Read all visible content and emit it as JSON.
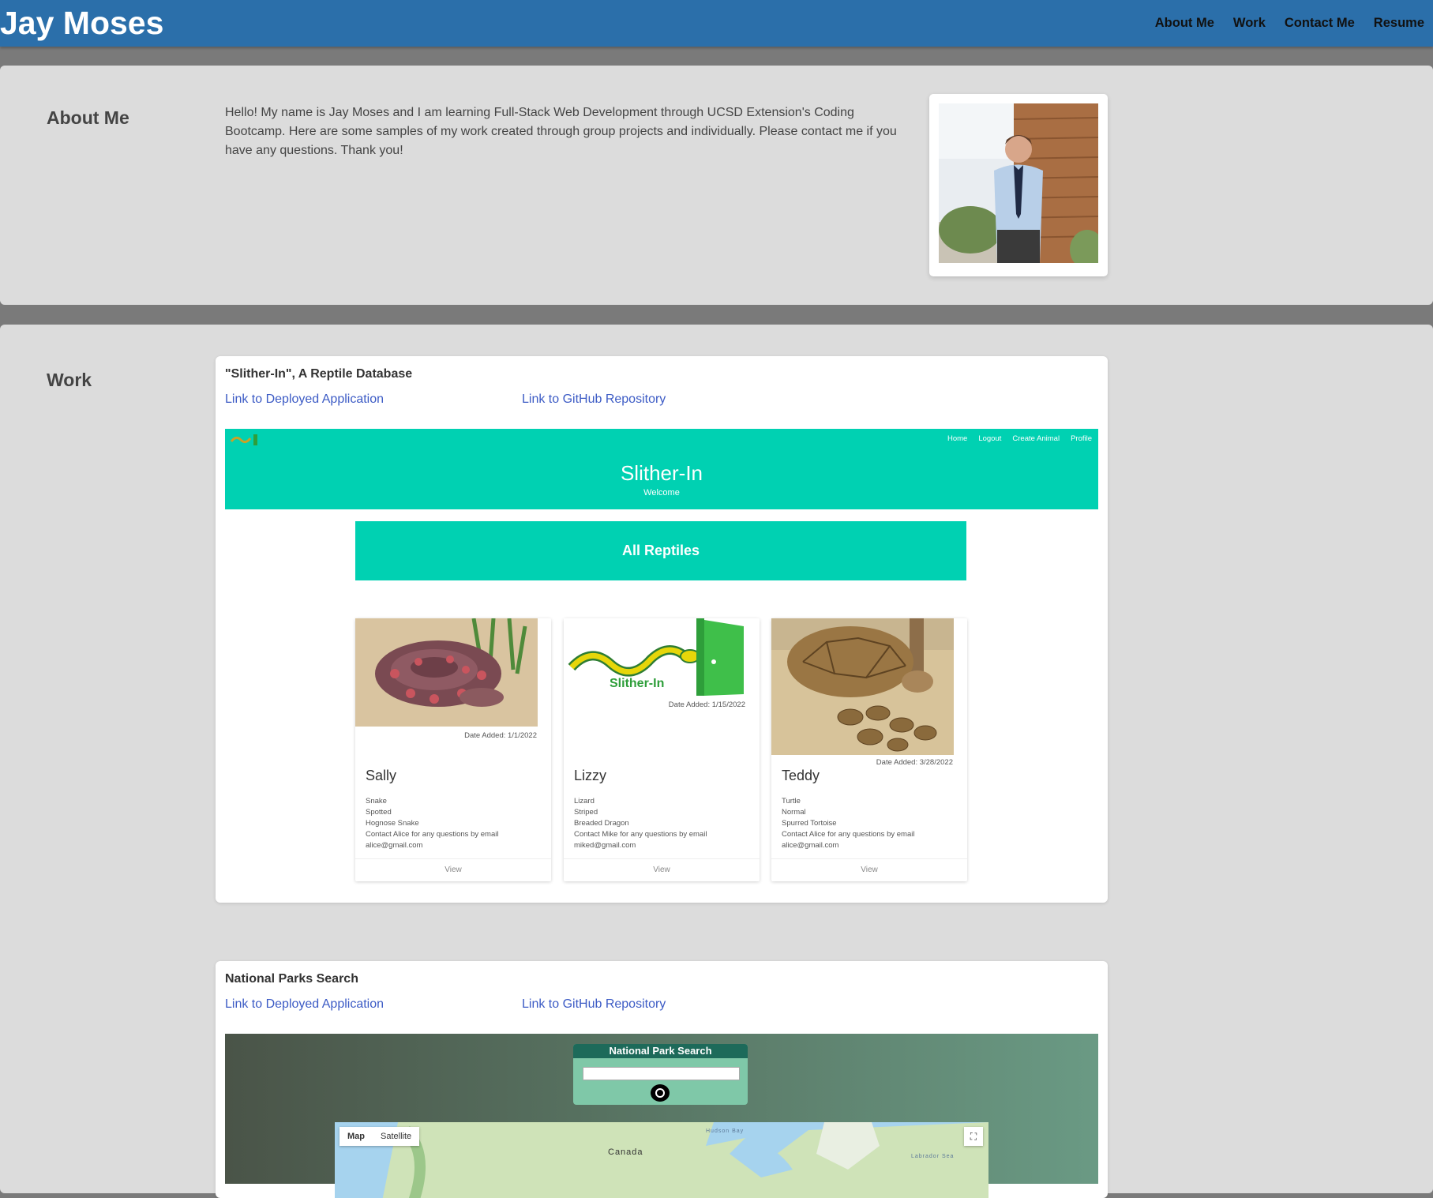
{
  "header": {
    "brand": "Jay Moses",
    "nav": [
      "About Me",
      "Work",
      "Contact Me",
      "Resume"
    ]
  },
  "about": {
    "title": "About Me",
    "text": "Hello! My name is Jay Moses and I am learning Full-Stack Web Development through UCSD Extension's Coding Bootcamp. Here are some samples of my work created through group projects and individually. Please contact me if you have any questions. Thank you!"
  },
  "work": {
    "title": "Work",
    "projects": [
      {
        "title": "\"Slither-In\", A Reptile Database",
        "deployed_link": "Link to Deployed Application",
        "repo_link": "Link to GitHub Repository",
        "screenshot": {
          "nav": [
            "Home",
            "Logout",
            "Create Animal",
            "Profile"
          ],
          "app_title": "Slither-In",
          "welcome": "Welcome",
          "banner": "All Reptiles",
          "logo_text": "Slither-In",
          "cards": [
            {
              "name": "Sally",
              "date": "Date Added: 1/1/2022",
              "details": [
                "Snake",
                "Spotted",
                "Hognose Snake",
                "Contact Alice for any questions by email",
                "alice@gmail.com"
              ],
              "view": "View"
            },
            {
              "name": "Lizzy",
              "date": "Date Added: 1/15/2022",
              "details": [
                "Lizard",
                "Striped",
                "Breaded Dragon",
                "Contact Mike for any questions by email",
                "miked@gmail.com"
              ],
              "view": "View"
            },
            {
              "name": "Teddy",
              "date": "Date Added: 3/28/2022",
              "details": [
                "Turtle",
                "Normal",
                "Spurred Tortoise",
                "Contact Alice for any questions by email",
                "alice@gmail.com"
              ],
              "view": "View"
            }
          ]
        }
      },
      {
        "title": "National Parks Search",
        "deployed_link": "Link to Deployed Application",
        "repo_link": "Link to GitHub Repository",
        "screenshot": {
          "search_title": "National Park Search",
          "map_tabs": [
            "Map",
            "Satellite"
          ],
          "map_label": "Canada",
          "map_label_2": "Hudson Bay",
          "map_label_3": "Labrador Sea"
        }
      }
    ]
  }
}
